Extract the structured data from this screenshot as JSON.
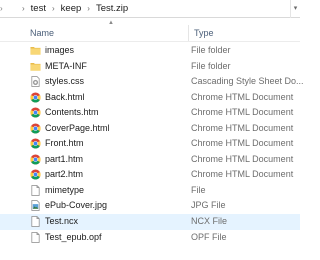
{
  "breadcrumb": {
    "parts": [
      "test",
      "keep",
      "Test.zip"
    ]
  },
  "columns": {
    "name": "Name",
    "type": "Type"
  },
  "files": [
    {
      "name": "images",
      "type": "File folder",
      "icon": "folder-icon"
    },
    {
      "name": "META-INF",
      "type": "File folder",
      "icon": "folder-icon"
    },
    {
      "name": "styles.css",
      "type": "Cascading Style Sheet Do...",
      "icon": "css-file-icon"
    },
    {
      "name": "Back.html",
      "type": "Chrome HTML Document",
      "icon": "chrome-icon"
    },
    {
      "name": "Contents.htm",
      "type": "Chrome HTML Document",
      "icon": "chrome-icon"
    },
    {
      "name": "CoverPage.html",
      "type": "Chrome HTML Document",
      "icon": "chrome-icon"
    },
    {
      "name": "Front.htm",
      "type": "Chrome HTML Document",
      "icon": "chrome-icon"
    },
    {
      "name": "part1.htm",
      "type": "Chrome HTML Document",
      "icon": "chrome-icon"
    },
    {
      "name": "part2.htm",
      "type": "Chrome HTML Document",
      "icon": "chrome-icon"
    },
    {
      "name": "mimetype",
      "type": "File",
      "icon": "generic-file-icon"
    },
    {
      "name": "ePub-Cover.jpg",
      "type": "JPG File",
      "icon": "image-file-icon"
    },
    {
      "name": "Test.ncx",
      "type": "NCX File",
      "icon": "generic-file-icon",
      "selected": true
    },
    {
      "name": "Test_epub.opf",
      "type": "OPF File",
      "icon": "generic-file-icon"
    }
  ],
  "colors": {
    "selection": "#e5f3ff",
    "folder": "#f8d775",
    "header_text": "#4c607a"
  }
}
